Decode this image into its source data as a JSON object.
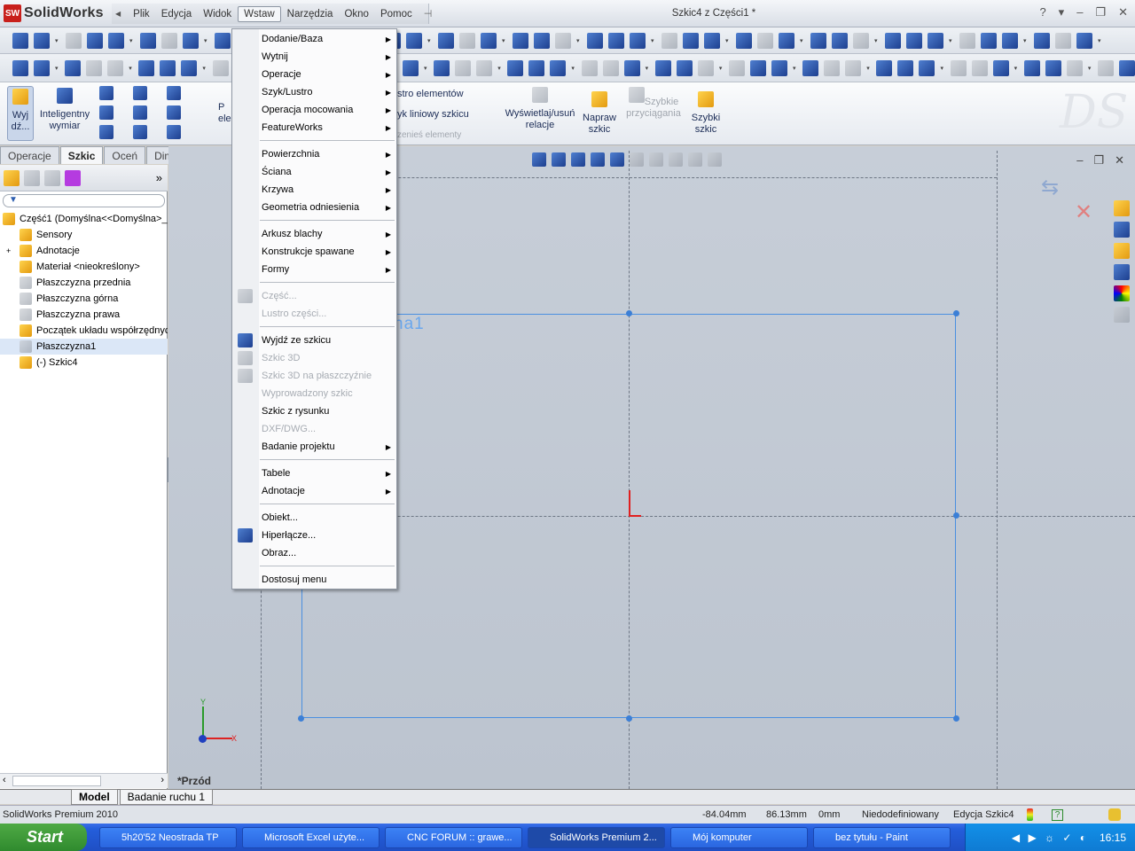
{
  "app": {
    "logo_text": "SolidWorks",
    "doc_title": "Szkic4 z Części1 *",
    "window_controls": [
      "?",
      "▾",
      "–",
      "❐",
      "✕"
    ]
  },
  "menubar": {
    "items": [
      "Plik",
      "Edycja",
      "Widok",
      "Wstaw",
      "Narzędzia",
      "Okno",
      "Pomoc"
    ],
    "active": "Wstaw"
  },
  "insert_menu": {
    "items": [
      {
        "label": "Dodanie/Baza",
        "submenu": true
      },
      {
        "label": "Wytnij",
        "submenu": true
      },
      {
        "label": "Operacje",
        "submenu": true
      },
      {
        "label": "Szyk/Lustro",
        "submenu": true
      },
      {
        "label": "Operacja mocowania",
        "submenu": true
      },
      {
        "label": "FeatureWorks",
        "submenu": true
      },
      {
        "sep": true
      },
      {
        "label": "Powierzchnia",
        "submenu": true
      },
      {
        "label": "Ściana",
        "submenu": true
      },
      {
        "label": "Krzywa",
        "submenu": true
      },
      {
        "label": "Geometria odniesienia",
        "submenu": true
      },
      {
        "sep": true
      },
      {
        "label": "Arkusz blachy",
        "submenu": true
      },
      {
        "label": "Konstrukcje spawane",
        "submenu": true
      },
      {
        "label": "Formy",
        "submenu": true
      },
      {
        "sep": true
      },
      {
        "label": "Część...",
        "disabled": true,
        "icon": "part-icon"
      },
      {
        "label": "Lustro części...",
        "disabled": true
      },
      {
        "sep": true
      },
      {
        "label": "Wyjdź ze szkicu",
        "icon": "exit-sketch-icon"
      },
      {
        "label": "Szkic 3D",
        "disabled": true,
        "icon": "sketch-3d-icon"
      },
      {
        "label": "Szkic 3D na płaszczyźnie",
        "disabled": true,
        "icon": "sketch-3d-plane-icon"
      },
      {
        "label": "Wyprowadzony szkic",
        "disabled": true
      },
      {
        "label": "Szkic z rysunku"
      },
      {
        "label": "DXF/DWG...",
        "disabled": true
      },
      {
        "label": "Badanie projektu",
        "submenu": true
      },
      {
        "sep": true
      },
      {
        "label": "Tabele",
        "submenu": true
      },
      {
        "label": "Adnotacje",
        "submenu": true
      },
      {
        "sep": true
      },
      {
        "label": "Obiekt..."
      },
      {
        "label": "Hiperłącze...",
        "icon": "hyperlink-icon"
      },
      {
        "label": "Obraz..."
      },
      {
        "sep": true
      },
      {
        "label": "Dostosuj menu"
      }
    ]
  },
  "command_manager": {
    "exit_sketch": "Wyj dź...",
    "smart_dimension": "Inteligentny wymiar",
    "partial_p": "P ele",
    "mirror": "stro elementów",
    "linear_pattern": "yk liniowy szkicu",
    "move": "zenieś elementy",
    "relations": "Wyświetlaj/usuń relacje",
    "repair": "Napraw szkic",
    "quick_snaps": "Szybkie przyciągania",
    "rapid_sketch": "Szybki szkic"
  },
  "tabs": [
    {
      "label": "Operacje"
    },
    {
      "label": "Szkic",
      "active": true
    },
    {
      "label": "Oceń"
    },
    {
      "label": "DimXpert Wyr"
    }
  ],
  "feature_tree": {
    "items": [
      {
        "label": "Część1  (Domyślna<<Domyślna>_",
        "icon": "part-icon",
        "level": 0
      },
      {
        "label": "Sensory",
        "icon": "sensor-icon",
        "level": 1
      },
      {
        "label": "Adnotacje",
        "icon": "annotation-icon",
        "level": 1,
        "expandable": true
      },
      {
        "label": "Materiał <nieokreślony>",
        "icon": "material-icon",
        "level": 1
      },
      {
        "label": "Płaszczyzna przednia",
        "icon": "plane-icon",
        "level": 1
      },
      {
        "label": "Płaszczyzna górna",
        "icon": "plane-icon",
        "level": 1
      },
      {
        "label": "Płaszczyzna prawa",
        "icon": "plane-icon",
        "level": 1
      },
      {
        "label": "Początek układu współrzędnych",
        "icon": "origin-icon",
        "level": 1
      },
      {
        "label": "Płaszczyzna1",
        "icon": "plane-icon",
        "level": 1,
        "selected": true
      },
      {
        "label": "(-) Szkic4",
        "icon": "sketch-icon",
        "level": 1
      }
    ]
  },
  "viewport": {
    "plane_label": "na1",
    "view_name": "*Przód",
    "axis_x": "X",
    "axis_y": "Y"
  },
  "bottom_tabs": [
    "Model",
    "Badanie ruchu 1"
  ],
  "status": {
    "product": "SolidWorks Premium 2010",
    "x": "-84.04mm",
    "y": "86.13mm",
    "z": "0mm",
    "state": "Niedodefiniowany",
    "mode": "Edycja Szkic4"
  },
  "taskbar": {
    "start": "Start",
    "tasks": [
      {
        "label": "5h20'52 Neostrada TP"
      },
      {
        "label": "Microsoft Excel użyte..."
      },
      {
        "label": "CNC FORUM :: grawe..."
      },
      {
        "label": "SolidWorks Premium 2...",
        "active": true
      },
      {
        "label": "Mój komputer"
      },
      {
        "label": "bez tytułu - Paint"
      }
    ],
    "clock": "16:15"
  },
  "colors": {
    "sketch_blue": "#3c7fd6",
    "viewport_bg": "#c3cad4",
    "taskbar_blue": "#245edb",
    "origin_red": "#e02020"
  }
}
